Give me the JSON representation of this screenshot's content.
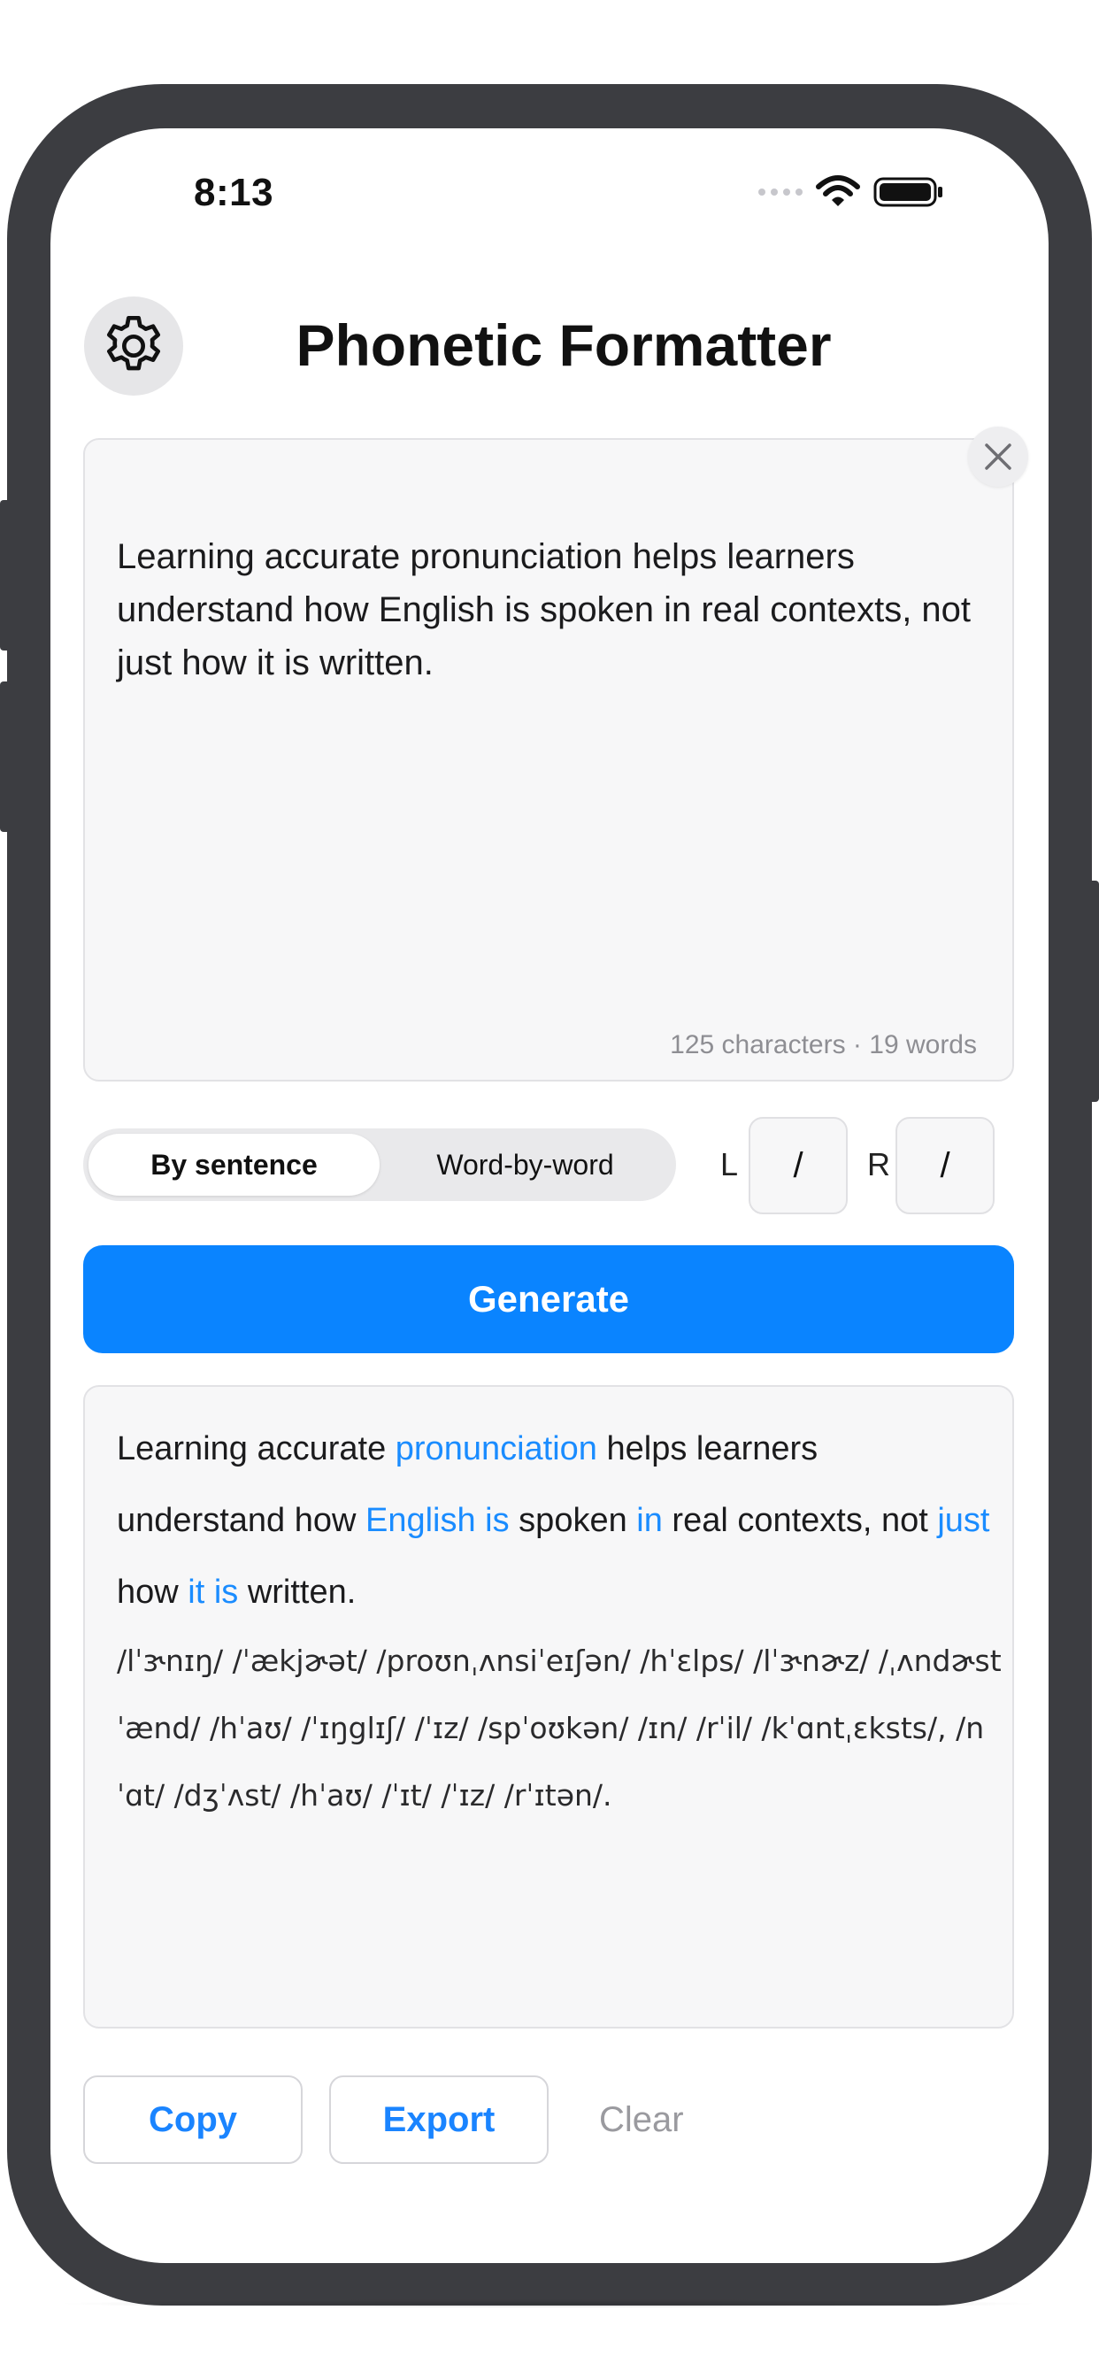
{
  "status": {
    "time": "8:13"
  },
  "header": {
    "title": "Phonetic Formatter",
    "settings_icon": "gear-icon"
  },
  "input": {
    "text": "Learning accurate pronunciation helps learners understand how English is spoken in real contexts, not just how it is written.",
    "counter": "125 characters · 19 words",
    "clear_icon": "close-icon"
  },
  "mode": {
    "options": [
      "By sentence",
      "Word-by-word"
    ],
    "selected": "By sentence"
  },
  "delimiters": {
    "left_label": "L",
    "left_value": "/",
    "right_label": "R",
    "right_value": "/"
  },
  "generate_label": "Generate",
  "output": {
    "tokens": [
      {
        "t": "Learning accurate ",
        "hl": false
      },
      {
        "t": "pronunciation",
        "hl": true
      },
      {
        "t": " helps learners understand how ",
        "hl": false
      },
      {
        "t": "English is",
        "hl": true
      },
      {
        "t": " spoken ",
        "hl": false
      },
      {
        "t": "in",
        "hl": true
      },
      {
        "t": " real contexts, not ",
        "hl": false
      },
      {
        "t": "just",
        "hl": true
      },
      {
        "t": " how ",
        "hl": false
      },
      {
        "t": "it is",
        "hl": true
      },
      {
        "t": " written.",
        "hl": false
      }
    ],
    "ipa": "/lˈɝnɪŋ/ /ˈækjɚət/ /proʊnˌʌnsiˈeɪʃən/ /hˈɛlps/ /lˈɝnɚz/ /ˌʌndɚstˈænd/ /hˈaʊ/ /ˈɪŋglɪʃ/ /ˈɪz/ /spˈoʊkən/ /ɪn/ /rˈil/ /kˈɑntˌɛksts/, /nˈɑt/ /dʒˈʌst/ /hˈaʊ/ /ˈɪt/ /ˈɪz/ /rˈɪtən/."
  },
  "actions": {
    "copy": "Copy",
    "export": "Export",
    "clear": "Clear"
  },
  "colors": {
    "accent": "#0a84ff",
    "highlight": "#1a8cff",
    "frame": "#3c3d41"
  }
}
